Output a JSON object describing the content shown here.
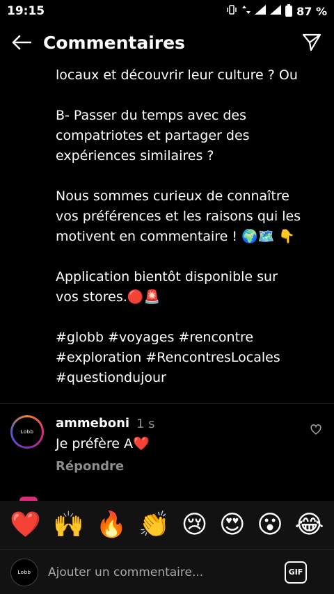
{
  "status_bar": {
    "time": "19:15",
    "network": "4G 3G",
    "battery_percent": "87 %"
  },
  "header": {
    "title": "Commentaires",
    "back_icon": "arrow-left-icon",
    "send_icon": "paper-plane-icon"
  },
  "caption": {
    "lines": [
      "locaux et découvrir leur culture ? Ou",
      "",
      "B- Passer du temps avec des",
      "compatriotes et partager des",
      "expériences similaires ?",
      "",
      "Nous sommes curieux de connaître",
      "vos préférences et les raisons qui les",
      "motivent en commentaire ! 🌍🗺️ 👇",
      "",
      "Application bientôt disponible sur",
      "vos stores.🔴🚨",
      "",
      "#globb #voyages #rencontre",
      "#exploration #RencontresLocales",
      "#questiondujour"
    ]
  },
  "comment": {
    "avatar_logo_text": "Lobb",
    "username": "ammeboni",
    "time": "1 s",
    "text": "Je préfère A❤️",
    "reply_label": "Répondre",
    "like_icon": "heart-outline-icon"
  },
  "emoji_bar": {
    "emojis": [
      "❤️",
      "🙌",
      "🔥",
      "👏",
      "😢",
      "😍",
      "😮",
      "😂"
    ]
  },
  "input_bar": {
    "placeholder": "Ajouter un commentaire...",
    "gif_label": "GIF"
  },
  "colors": {
    "background": "#000000",
    "muted_text": "#8e8e8e",
    "bar_background": "#121212"
  }
}
